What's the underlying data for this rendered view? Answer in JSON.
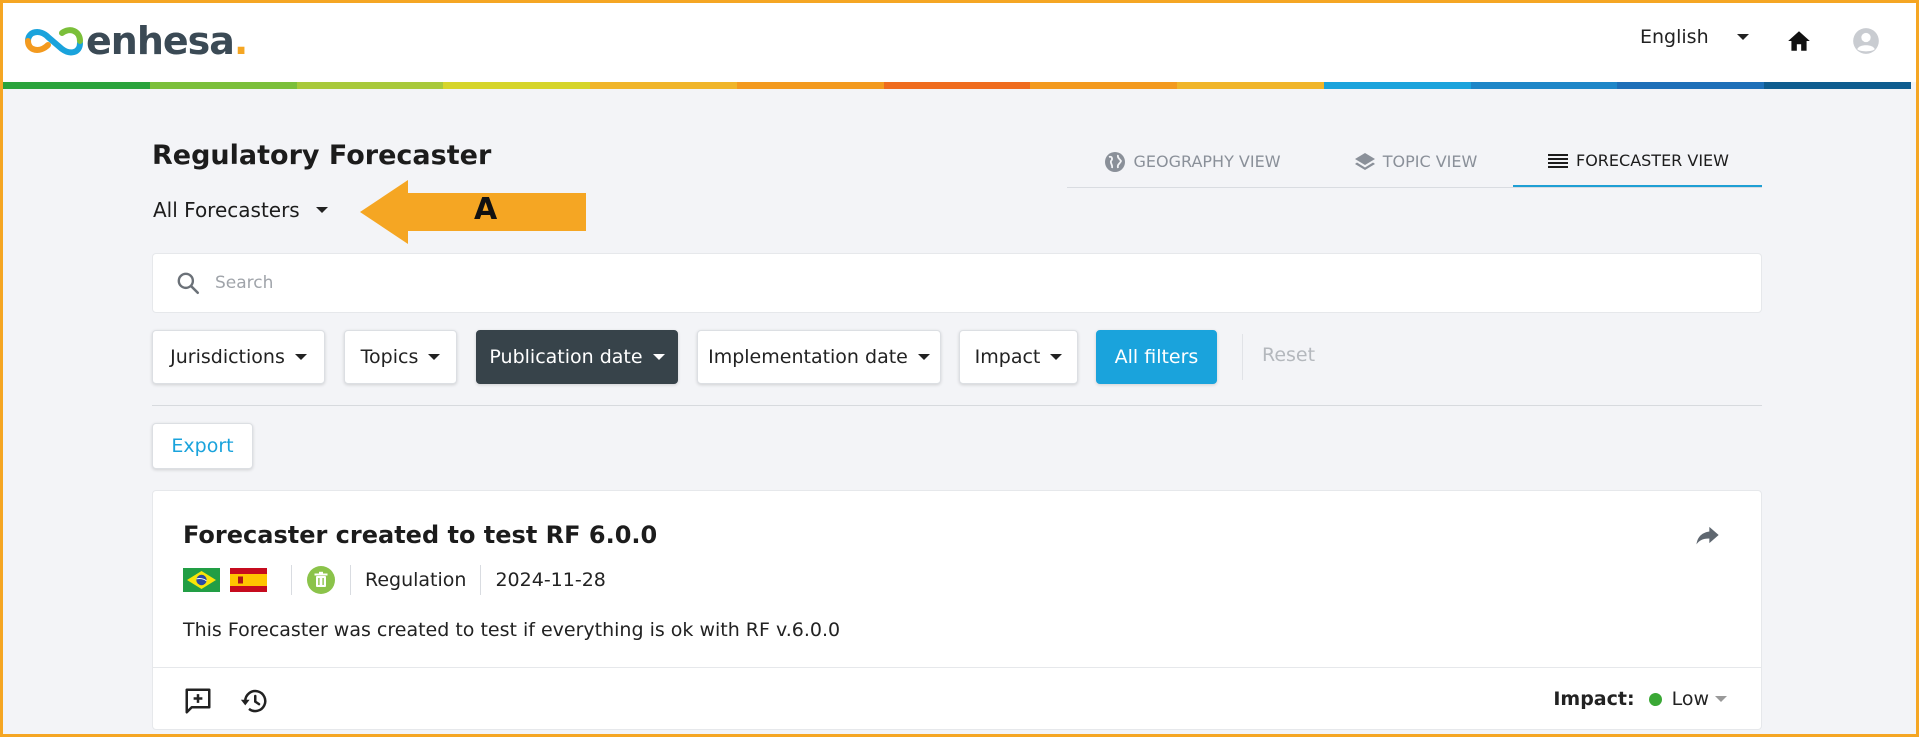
{
  "header": {
    "brand": "enhesa",
    "brand_dot": ".",
    "language": "English",
    "icons": {
      "home": "home-icon",
      "user": "user-icon"
    },
    "color_bar": [
      "#2aa33c",
      "#7bbf3a",
      "#a8c93a",
      "#d6d52a",
      "#f0b52a",
      "#f39a1f",
      "#ef6c1f",
      "#f39a1f",
      "#f0b52a",
      "#1aa3dc",
      "#1d86c8",
      "#1d6fb8",
      "#0e5c8f"
    ]
  },
  "page": {
    "title": "Regulatory Forecaster",
    "forecaster_select": "All Forecasters"
  },
  "annotation": {
    "label": "A",
    "color": "#f5a623"
  },
  "view_tabs": [
    {
      "label": "GEOGRAPHY VIEW",
      "icon": "globe-icon",
      "active": false
    },
    {
      "label": "TOPIC VIEW",
      "icon": "layers-icon",
      "active": false
    },
    {
      "label": "FORECASTER VIEW",
      "icon": "list-icon",
      "active": true
    }
  ],
  "search": {
    "placeholder": "Search",
    "value": ""
  },
  "filters": {
    "jurisdictions": "Jurisdictions",
    "topics": "Topics",
    "publication_date": "Publication date",
    "implementation_date": "Implementation date",
    "impact": "Impact",
    "all_filters": "All filters",
    "reset": "Reset"
  },
  "export_label": "Export",
  "card": {
    "title": "Forecaster created to test RF 6.0.0",
    "flags": [
      "brazil-flag",
      "spain-flag"
    ],
    "topic_icon": "recycle-icon",
    "type": "Regulation",
    "date": "2024-11-28",
    "description": "This Forecaster was created to test if everything is ok with RF v.6.0.0",
    "impact_label": "Impact:",
    "impact_value": "Low",
    "impact_color": "#3aa835"
  }
}
